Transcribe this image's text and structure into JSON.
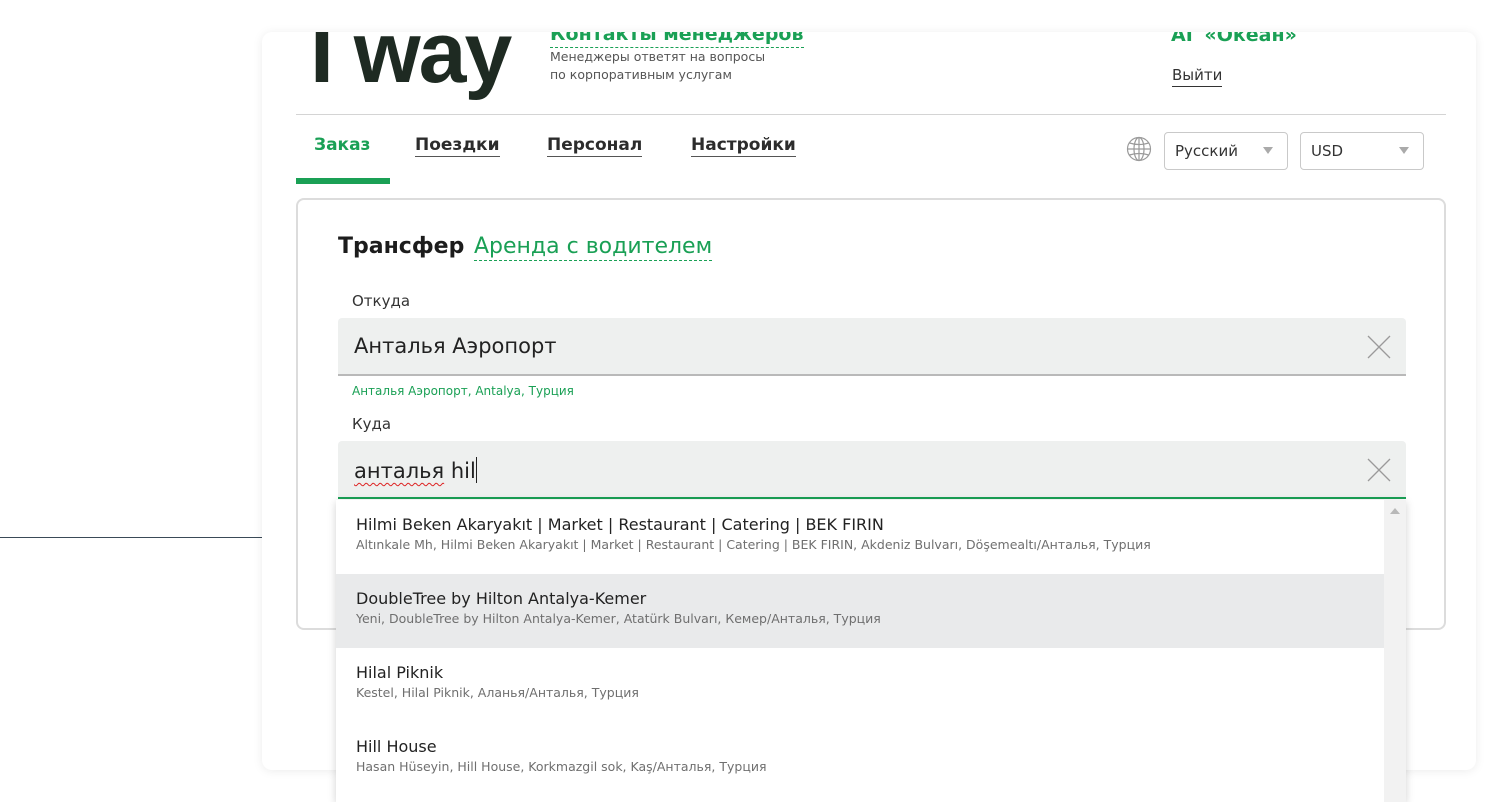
{
  "header": {
    "logo": "I way",
    "contacts_link": "Контакты менеджеров",
    "contacts_desc_line1": "Менеджеры ответят на вопросы",
    "contacts_desc_line2": "по корпоративным услугам",
    "company_name": "АГ «Океан»",
    "logout": "Выйти"
  },
  "nav": {
    "tabs": [
      {
        "label": "Заказ",
        "active": true
      },
      {
        "label": "Поездки"
      },
      {
        "label": "Персонал"
      },
      {
        "label": "Настройки"
      }
    ],
    "language": "Русский",
    "currency": "USD"
  },
  "form": {
    "service_active": "Трансфер",
    "service_alt": "Аренда с водителем",
    "from_label": "Откуда",
    "from_value": "Анталья Аэропорт",
    "from_hint": "Анталья Аэропорт, Antalya, Турция",
    "to_label": "Куда",
    "to_value_word": "анталья",
    "to_value_rest": " hil"
  },
  "suggestions": [
    {
      "name": "Hilmi Beken Akaryakıt | Market | Restaurant | Catering | BEK FIRIN",
      "address": "Altınkale Mh, Hilmi Beken Akaryakıt | Market | Restaurant | Catering | BEK FIRIN, Akdeniz Bulvarı, Döşemealtı/Анталья, Турция"
    },
    {
      "name": "DoubleTree by Hilton Antalya-Kemer",
      "address": "Yeni, DoubleTree by Hilton Antalya-Kemer, Atatürk Bulvarı, Кемер/Анталья, Турция",
      "hover": true
    },
    {
      "name": "Hilal Piknik",
      "address": "Kestel, Hilal Piknik, Аланья/Анталья, Турция"
    },
    {
      "name": "Hill House",
      "address": "Hasan Hüseyin, Hill House, Korkmazgil sok, Kaş/Анталья, Турция"
    }
  ],
  "colors": {
    "accent": "#1aa055",
    "hover_row": "#e9eaeb",
    "field_bg": "#eef0ef"
  }
}
